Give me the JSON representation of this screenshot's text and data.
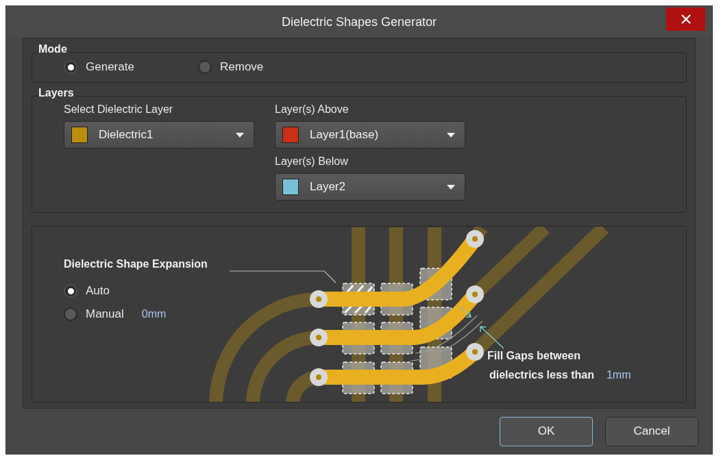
{
  "window": {
    "title": "Dielectric Shapes Generator"
  },
  "mode": {
    "label": "Mode",
    "options": [
      {
        "label": "Generate",
        "selected": true
      },
      {
        "label": "Remove",
        "selected": false
      }
    ]
  },
  "layers": {
    "label": "Layers",
    "columns": [
      [
        {
          "label": "Select Dielectric Layer",
          "value": "Dielectric1",
          "color": "#b8900e"
        }
      ],
      [
        {
          "label": "Layer(s) Above",
          "value": "Layer1(base)",
          "color": "#c83018"
        },
        {
          "label": "Layer(s) Below",
          "value": "Layer2",
          "color": "#78c0d8"
        }
      ]
    ]
  },
  "expansion": {
    "label": "Dielectric Shape Expansion",
    "options": [
      {
        "label": "Auto",
        "selected": true
      },
      {
        "label": "Manual",
        "selected": false,
        "value": "0mm"
      }
    ]
  },
  "fill_gaps": {
    "lines": [
      "Fill Gaps between",
      "dielectrics less than"
    ],
    "value": "1mm"
  },
  "buttons": [
    {
      "label": "OK",
      "default": true
    },
    {
      "label": "Cancel",
      "default": false
    }
  ]
}
